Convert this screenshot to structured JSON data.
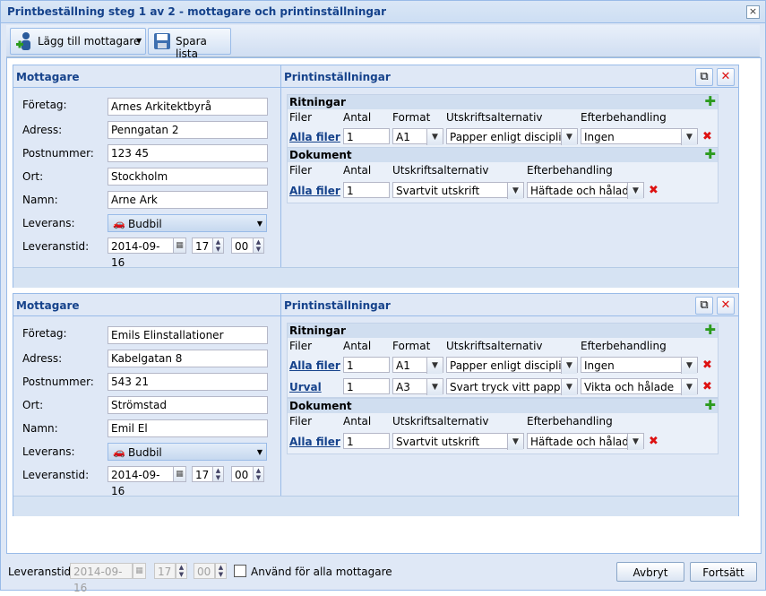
{
  "window": {
    "title": "Printbeställning steg 1 av 2 - mottagare och printinställningar",
    "close_icon": "×"
  },
  "toolbar": {
    "add_recipient_label": "Lägg till mottagare",
    "save_list_label": "Spara lista"
  },
  "labels": {
    "recipient_header": "Mottagare",
    "print_settings_header": "Printinställningar",
    "company": "Företag:",
    "address": "Adress:",
    "postal_code": "Postnummer:",
    "city": "Ort:",
    "name": "Namn:",
    "delivery": "Leverans:",
    "delivery_time": "Leveranstid:",
    "drawings": "Ritningar",
    "documents": "Dokument",
    "col_files": "Filer",
    "col_quantity": "Antal",
    "col_format": "Format",
    "col_print_option": "Utskriftsalternativ",
    "col_post_processing": "Efterbehandling"
  },
  "recipients": [
    {
      "company": "Arnes Arkitektbyrå",
      "address": "Penngatan 2",
      "postal_code": "123 45",
      "city": "Stockholm",
      "name": "Arne Ark",
      "delivery": "Budbil",
      "date": "2014-09-16",
      "hour": "17",
      "minute": "00",
      "drawings": [
        {
          "files": "Alla filer",
          "quantity": "1",
          "format": "A1",
          "print_option": "Papper enligt disciplin",
          "post_processing": "Ingen"
        }
      ],
      "documents": [
        {
          "files": "Alla filer",
          "quantity": "1",
          "print_option": "Svartvit utskrift",
          "post_processing": "Häftade och hålade"
        }
      ]
    },
    {
      "company": "Emils Elinstallationer",
      "address": "Kabelgatan 8",
      "postal_code": "543 21",
      "city": "Strömstad",
      "name": "Emil El",
      "delivery": "Budbil",
      "date": "2014-09-16",
      "hour": "17",
      "minute": "00",
      "drawings": [
        {
          "files": "Alla filer",
          "quantity": "1",
          "format": "A1",
          "print_option": "Papper enligt disciplin",
          "post_processing": "Ingen"
        },
        {
          "files": "Urval",
          "quantity": "1",
          "format": "A3",
          "print_option": "Svart tryck vitt papper",
          "post_processing": "Vikta och hålade"
        }
      ],
      "documents": [
        {
          "files": "Alla filer",
          "quantity": "1",
          "print_option": "Svartvit utskrift",
          "post_processing": "Häftade och hålade"
        }
      ]
    }
  ],
  "footer": {
    "delivery_time_label": "Leveranstid:",
    "date": "2014-09-16",
    "hour": "17",
    "minute": "00",
    "apply_all_label": "Använd för alla mottagare",
    "cancel_label": "Avbryt",
    "continue_label": "Fortsätt"
  },
  "colors": {
    "header_text": "#15428b",
    "panel_bg": "#dfe8f6",
    "border": "#99bbe8",
    "add_green": "#2c9b1e",
    "delete_red": "#dd1111"
  }
}
